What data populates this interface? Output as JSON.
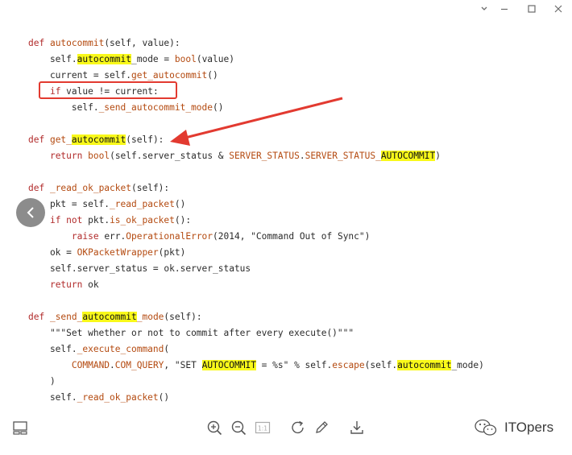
{
  "window": {
    "controls": [
      "dropdown-icon",
      "minimize-icon",
      "maximize-icon",
      "close-icon"
    ],
    "minimize_glyph": "—",
    "maximize_glyph": "☐",
    "close_glyph": "✕"
  },
  "code": {
    "lines": [
      [
        {
          "t": "def ",
          "c": "kw"
        },
        {
          "t": "autocommit",
          "c": "fn"
        },
        {
          "t": "(self, value):",
          "c": ""
        }
      ],
      [
        {
          "t": "    self.",
          "c": ""
        },
        {
          "t": "autocommit",
          "c": "hl"
        },
        {
          "t": "_mode = ",
          "c": ""
        },
        {
          "t": "bool",
          "c": "fn"
        },
        {
          "t": "(value)",
          "c": ""
        }
      ],
      [
        {
          "t": "    current = self.",
          "c": ""
        },
        {
          "t": "get_autocommit",
          "c": "fn"
        },
        {
          "t": "()",
          "c": ""
        }
      ],
      [
        {
          "t": "    ",
          "c": ""
        },
        {
          "t": "if",
          "c": "kw"
        },
        {
          "t": " value != current:",
          "c": ""
        }
      ],
      [
        {
          "t": "        self.",
          "c": ""
        },
        {
          "t": "_send_autocommit_mode",
          "c": "fn"
        },
        {
          "t": "()",
          "c": ""
        }
      ],
      [],
      [
        {
          "t": "def ",
          "c": "kw"
        },
        {
          "t": "get_",
          "c": "fn"
        },
        {
          "t": "autocommit",
          "c": "hl"
        },
        {
          "t": "(self):",
          "c": ""
        }
      ],
      [
        {
          "t": "    ",
          "c": ""
        },
        {
          "t": "return",
          "c": "kw"
        },
        {
          "t": " ",
          "c": ""
        },
        {
          "t": "bool",
          "c": "fn"
        },
        {
          "t": "(self.server_status & ",
          "c": ""
        },
        {
          "t": "SERVER_STATUS",
          "c": "fn"
        },
        {
          "t": ".",
          "c": ""
        },
        {
          "t": "SERVER_STATUS_",
          "c": "fn"
        },
        {
          "t": "AUTOCOMMIT",
          "c": "hl"
        },
        {
          "t": ")",
          "c": ""
        }
      ],
      [],
      [
        {
          "t": "def ",
          "c": "kw"
        },
        {
          "t": "_read_ok_packet",
          "c": "fn"
        },
        {
          "t": "(self):",
          "c": ""
        }
      ],
      [
        {
          "t": "    pkt = self.",
          "c": ""
        },
        {
          "t": "_read_packet",
          "c": "fn"
        },
        {
          "t": "()",
          "c": ""
        }
      ],
      [
        {
          "t": "    ",
          "c": ""
        },
        {
          "t": "if not",
          "c": "kw"
        },
        {
          "t": " pkt.",
          "c": ""
        },
        {
          "t": "is_ok_packet",
          "c": "fn"
        },
        {
          "t": "():",
          "c": ""
        }
      ],
      [
        {
          "t": "        ",
          "c": ""
        },
        {
          "t": "raise",
          "c": "kw"
        },
        {
          "t": " err.",
          "c": ""
        },
        {
          "t": "OperationalError",
          "c": "fn"
        },
        {
          "t": "(2014, \"Command Out of Sync\")",
          "c": ""
        }
      ],
      [
        {
          "t": "    ok = ",
          "c": ""
        },
        {
          "t": "OKPacketWrapper",
          "c": "fn"
        },
        {
          "t": "(pkt)",
          "c": ""
        }
      ],
      [
        {
          "t": "    self.server_status = ok.server_status",
          "c": ""
        }
      ],
      [
        {
          "t": "    ",
          "c": ""
        },
        {
          "t": "return",
          "c": "kw"
        },
        {
          "t": " ok",
          "c": ""
        }
      ],
      [],
      [
        {
          "t": "def ",
          "c": "kw"
        },
        {
          "t": "_send_",
          "c": "fn"
        },
        {
          "t": "autocommit",
          "c": "hl"
        },
        {
          "t": "_mode",
          "c": "fn"
        },
        {
          "t": "(self):",
          "c": ""
        }
      ],
      [
        {
          "t": "    \"\"\"Set whether or not to commit after every execute()\"\"\"",
          "c": ""
        }
      ],
      [
        {
          "t": "    self.",
          "c": ""
        },
        {
          "t": "_execute_command",
          "c": "fn"
        },
        {
          "t": "(",
          "c": ""
        }
      ],
      [
        {
          "t": "        ",
          "c": ""
        },
        {
          "t": "COMMAND",
          "c": "fn"
        },
        {
          "t": ".",
          "c": ""
        },
        {
          "t": "COM_QUERY",
          "c": "fn"
        },
        {
          "t": ", \"SET ",
          "c": ""
        },
        {
          "t": "AUTOCOMMIT",
          "c": "hl"
        },
        {
          "t": " = %s\" % self.",
          "c": ""
        },
        {
          "t": "escape",
          "c": "fn"
        },
        {
          "t": "(self.",
          "c": ""
        },
        {
          "t": "autocommit",
          "c": "hl"
        },
        {
          "t": "_mode)",
          "c": ""
        }
      ],
      [
        {
          "t": "    )",
          "c": ""
        }
      ],
      [
        {
          "t": "    self.",
          "c": ""
        },
        {
          "t": "_read_ok_packet",
          "c": "fn"
        },
        {
          "t": "()",
          "c": ""
        }
      ]
    ]
  },
  "toolbar": {
    "icons": [
      "layout-icon",
      "zoom-in-icon",
      "zoom-out-icon",
      "actual-size-icon",
      "rotate-icon",
      "edit-icon",
      "download-icon"
    ],
    "actual_size_label": "1:1"
  },
  "brand": {
    "name": "ITOpers"
  },
  "colors": {
    "keyword": "#b12a2a",
    "function": "#b44a10",
    "highlight": "#f9f91a",
    "annotation": "#e23a30"
  }
}
